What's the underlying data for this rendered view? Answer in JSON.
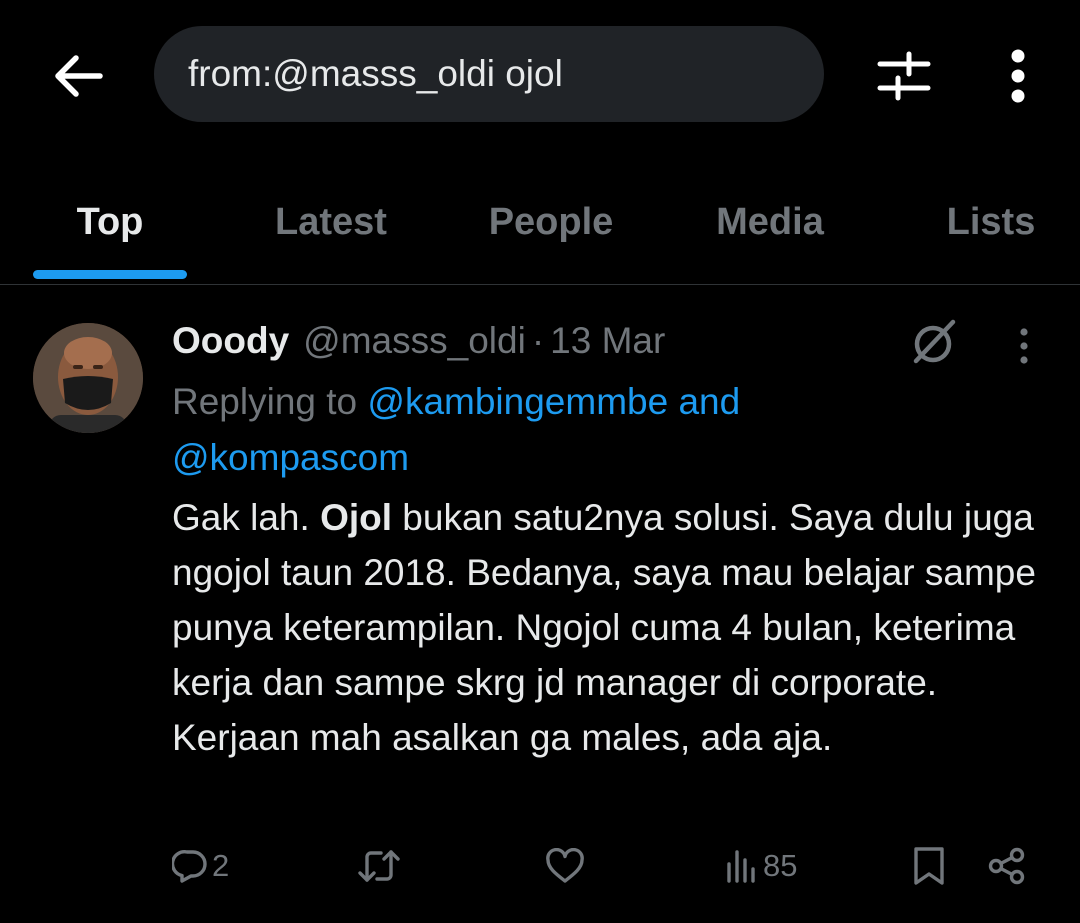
{
  "search": {
    "query": "from:@masss_oldi ojol"
  },
  "tabs": [
    {
      "label": "Top",
      "active": true
    },
    {
      "label": "Latest"
    },
    {
      "label": "People"
    },
    {
      "label": "Media"
    },
    {
      "label": "Lists"
    }
  ],
  "tweet": {
    "author_name": "Ooody",
    "author_handle": "@masss_oldi",
    "separator": "·",
    "date": "13 Mar",
    "replying_prefix": "Replying to",
    "reply_mention_1": "@kambingemmbe",
    "reply_and": "and",
    "reply_mention_2": "@kompascom",
    "text_before": "Gak lah. ",
    "text_bold": "Ojol",
    "text_after": " bukan satu2nya solusi. Saya dulu juga ngojol taun 2018. Bedanya, saya mau belajar sampe punya keterampilan. Ngojol cuma 4 bulan, keterima kerja dan sampe skrg jd manager di corporate. Kerjaan mah asalkan ga males, ada aja.",
    "reply_count": "2",
    "retweet_count": "",
    "like_count": "",
    "view_count": "85"
  },
  "icons": {
    "back": "arrow-left-icon",
    "filter": "sliders-icon",
    "more": "more-vertical-icon",
    "grok": "grok-icon",
    "reply": "reply-icon",
    "retweet": "retweet-icon",
    "like": "heart-icon",
    "views": "views-icon",
    "bookmark": "bookmark-icon",
    "share": "share-icon"
  },
  "colors": {
    "accent": "#1d9bf0",
    "background": "#000000",
    "muted": "#71767b",
    "search_bg": "#202327"
  }
}
